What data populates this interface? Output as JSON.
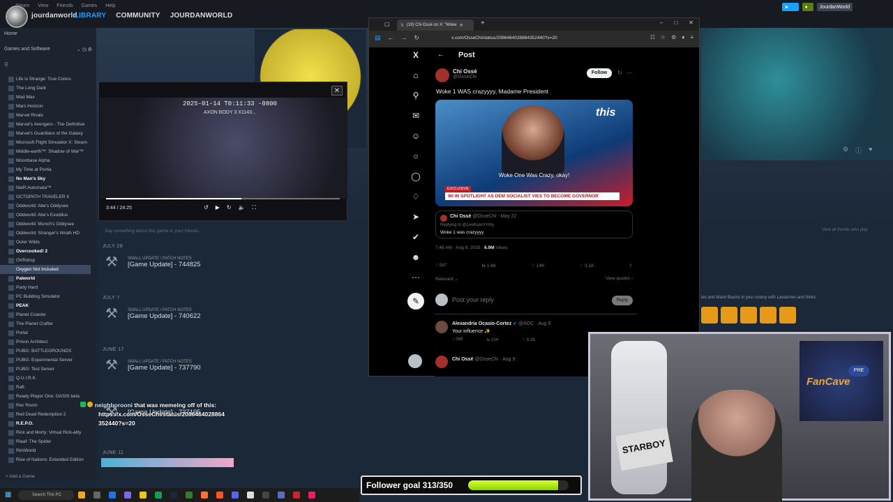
{
  "steam": {
    "menu": [
      "Steam",
      "View",
      "Friends",
      "Games",
      "Help"
    ],
    "nav": [
      "LIBRARY",
      "COMMUNITY",
      "JOURDANWORLD"
    ],
    "username": "jourdanworld",
    "account_name": "JourdanWorld",
    "home": "Home",
    "filter_label": "Games and Software",
    "add_game": "Add a Game",
    "friends_hint": "Say something about this game to your friends...",
    "all_friends": "View all friends who play",
    "toilet_hint": "ies and Wash Basins in your colony with Lavatories and Sinks."
  },
  "sidebar": {
    "games": [
      {
        "name": "Life is Strange: True Colors",
        "style": ""
      },
      {
        "name": "The Long Dark",
        "style": ""
      },
      {
        "name": "Mad Max",
        "style": ""
      },
      {
        "name": "Mars Horizon",
        "style": ""
      },
      {
        "name": "Marvel Rivals",
        "style": ""
      },
      {
        "name": "Marvel's Avengers - The Definitive",
        "style": ""
      },
      {
        "name": "Marvel's Guardians of the Galaxy",
        "style": ""
      },
      {
        "name": "Microsoft Flight Simulator X: Steam",
        "style": ""
      },
      {
        "name": "Middle-earth™: Shadow of War™",
        "style": ""
      },
      {
        "name": "Moonbase Alpha",
        "style": ""
      },
      {
        "name": "My Time at Portia",
        "style": ""
      },
      {
        "name": "No Man's Sky",
        "style": "bold"
      },
      {
        "name": "NieR:Automata™",
        "style": ""
      },
      {
        "name": "OCTOPATH TRAVELER II",
        "style": ""
      },
      {
        "name": "Oddworld: Abe's Oddysee",
        "style": ""
      },
      {
        "name": "Oddworld: Abe's Exoddus",
        "style": ""
      },
      {
        "name": "Oddworld: Munch's Oddysee",
        "style": ""
      },
      {
        "name": "Oddworld: Stranger's Wrath HD",
        "style": ""
      },
      {
        "name": "Outer Wilds",
        "style": ""
      },
      {
        "name": "Overcooked! 2",
        "style": "bold"
      },
      {
        "name": "OVRdrop",
        "style": ""
      },
      {
        "name": "Oxygen Not Included",
        "style": "sel"
      },
      {
        "name": "Palworld",
        "style": "bold"
      },
      {
        "name": "Party Hard",
        "style": ""
      },
      {
        "name": "PC Building Simulator",
        "style": ""
      },
      {
        "name": "PEAK",
        "style": "bold"
      },
      {
        "name": "Planet Coaster",
        "style": ""
      },
      {
        "name": "The Planet Crafter",
        "style": ""
      },
      {
        "name": "Portal",
        "style": ""
      },
      {
        "name": "Prison Architect",
        "style": ""
      },
      {
        "name": "PUBG: BATTLEGROUNDS",
        "style": ""
      },
      {
        "name": "PUBG: Experimental Server",
        "style": ""
      },
      {
        "name": "PUBG: Test Server",
        "style": ""
      },
      {
        "name": "Q.U.I.R.K.",
        "style": ""
      },
      {
        "name": "Raft",
        "style": ""
      },
      {
        "name": "Ready Player One: OASIS beta",
        "style": ""
      },
      {
        "name": "Rec Room",
        "style": ""
      },
      {
        "name": "Red Dead Redemption 2",
        "style": ""
      },
      {
        "name": "R.E.P.O.",
        "style": "bold"
      },
      {
        "name": "Rick and Morty: Virtual Rick-ality",
        "style": ""
      },
      {
        "name": "Riaaf: The Spider",
        "style": ""
      },
      {
        "name": "RimWorld",
        "style": ""
      },
      {
        "name": "Rise of Nations: Extended Edition",
        "style": ""
      }
    ]
  },
  "updates": [
    {
      "date": "JULY 28",
      "type": "SMALL UPDATE / PATCH NOTES",
      "title": "[Game Update] - 744825"
    },
    {
      "date": "JULY 7",
      "type": "SMALL UPDATE / PATCH NOTES",
      "title": "[Game Update] - 740622"
    },
    {
      "date": "JUNE 17",
      "type": "SMALL UPDATE / PATCH NOTES",
      "title": "[Game Update] - 737790"
    },
    {
      "date": "",
      "type": "",
      "title": "[Game Update] - 737195"
    },
    {
      "date": "JUNE 11",
      "type": "",
      "title": ""
    }
  ],
  "video": {
    "timestamp": "2025-01-14 T0:11:33 -0800",
    "watermark": "AXON BODY 3 X1143...",
    "time": "3:44 / 24:25",
    "progress": 0.58
  },
  "browser": {
    "tab_title": "(19) Chi Ossé on X: \"Woke",
    "url": "x.com/OsseChi/status/2086464028864352440?s=20"
  },
  "x_post": {
    "header": "Post",
    "author_name": "Chi Ossé",
    "author_handle": "@OsseChi",
    "follow": "Follow",
    "text": "Woke 1 WAS crazyyyy, Madame President",
    "image_caption": "Woke One Was Crazy, okay!",
    "image_chyron": "WI IN SPOTLIGHT AS DEM SOCIALIST VIES TO BECOME GOVERNOR",
    "image_exclusive": "EXCLUSIVE",
    "quote_name": "Chi Ossé",
    "quote_handle": "@OsseChi · May 22",
    "quote_reply_to": "Replying to @LeeKuanYmhy",
    "quote_text": "Woke 1 was crazyyyy",
    "meta_time": "7:46 AM · Aug 9, 2025 · ",
    "meta_views": "6.9M",
    "meta_views_label": " Views",
    "stats": {
      "replies": "587",
      "reposts": "1.6K",
      "likes": "14K",
      "bookmarks": "3.1K"
    },
    "relevant": "Relevant",
    "view_quotes": "View quotes",
    "reply_placeholder": "Post your reply",
    "reply_button": "Reply",
    "reply1_name": "Alexandria Ocasio-Cortez",
    "reply1_handle": "@AOC · Aug 9",
    "reply1_text": "Your influence ✨",
    "reply1_stats": {
      "replies": "269",
      "reposts": "104",
      "likes": "6.3K"
    },
    "reply2_name": "Chi Ossé",
    "reply2_handle": "@OsseChi · Aug 9"
  },
  "webcam": {
    "sign": "STARBOY",
    "poster": "FanCave",
    "poster_small": "PRE"
  },
  "chat": {
    "user": "neighborooni",
    "message_line1": "that was memeing off of this:",
    "message_line2": "https://x.com/OsseChi/status/2086464028864",
    "message_line3": "352440?s=20"
  },
  "goal": {
    "label": "Follower goal 313/350",
    "current": 313,
    "target": 350
  },
  "taskbar": {
    "search": "Search This PC"
  },
  "colors": {
    "steam_bg": "#1b2838",
    "steam_accent": "#1a9fff",
    "x_blue": "#1d9bf0",
    "goal_green": "#b6f21b"
  }
}
